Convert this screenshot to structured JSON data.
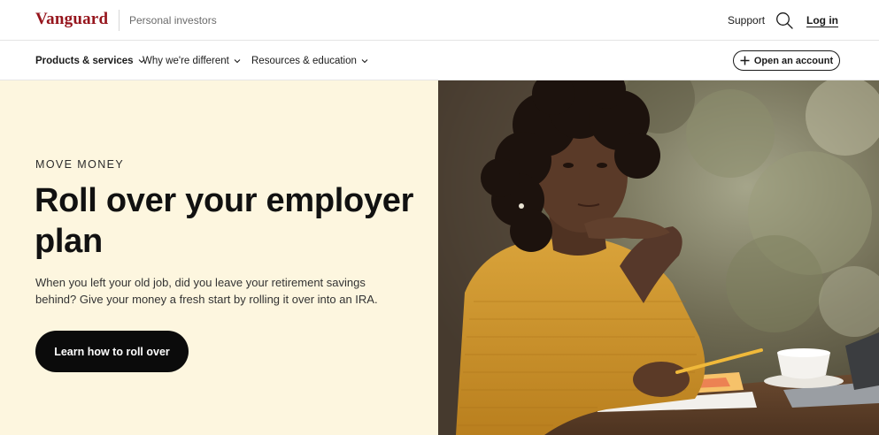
{
  "header": {
    "logo": "Vanguard",
    "segment": "Personal investors",
    "support": "Support",
    "login": "Log in"
  },
  "nav": {
    "items": [
      {
        "label": "Products & services",
        "active": true
      },
      {
        "label": "Why we're different",
        "active": false
      },
      {
        "label": "Resources & education",
        "active": false
      }
    ],
    "open_account": "Open an account"
  },
  "hero": {
    "eyebrow": "MOVE MONEY",
    "title": "Roll over your employer plan",
    "body": "When you left your old job, did you leave your retirement savings behind? Give your money a fresh start by rolling it over into an IRA.",
    "cta": "Learn how to roll over"
  },
  "colors": {
    "brand": "#96151d",
    "hero_bg": "#fdf6df",
    "cta_bg": "#0b0b0b"
  }
}
